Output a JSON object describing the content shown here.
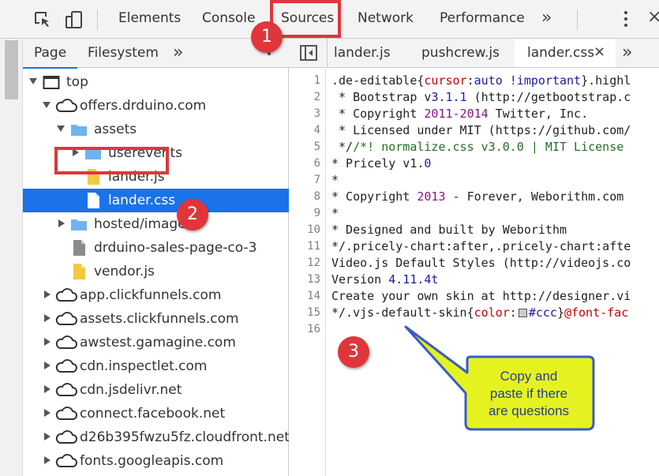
{
  "toolbar": {
    "tabs": [
      "Elements",
      "Console",
      "Sources",
      "Network",
      "Performance"
    ],
    "more": "»",
    "close": "×"
  },
  "navigator": {
    "tabs": [
      "Page",
      "Filesystem"
    ],
    "more": "»",
    "tree": [
      {
        "label": "top",
        "icon": "frame-icon",
        "expanded": true
      },
      {
        "label": "offers.drduino.com",
        "icon": "cloud-icon",
        "expanded": true
      },
      {
        "label": "assets",
        "icon": "folder-icon",
        "expanded": true
      },
      {
        "label": "userevents",
        "icon": "folder-icon",
        "expanded": false
      },
      {
        "label": "lander.js",
        "icon": "js-file-icon"
      },
      {
        "label": "lander.css",
        "icon": "css-file-icon",
        "selected": true
      },
      {
        "label": "hosted/images",
        "icon": "folder-icon",
        "expanded": false
      },
      {
        "label": "drduino-sales-page-co-3",
        "icon": "file-icon"
      },
      {
        "label": "vendor.js",
        "icon": "js-file-icon"
      },
      {
        "label": "app.clickfunnels.com",
        "icon": "cloud-icon",
        "expanded": false
      },
      {
        "label": "assets.clickfunnels.com",
        "icon": "cloud-icon",
        "expanded": false
      },
      {
        "label": "awstest.gamagine.com",
        "icon": "cloud-icon",
        "expanded": false
      },
      {
        "label": "cdn.inspectlet.com",
        "icon": "cloud-icon",
        "expanded": false
      },
      {
        "label": "cdn.jsdelivr.net",
        "icon": "cloud-icon",
        "expanded": false
      },
      {
        "label": "connect.facebook.net",
        "icon": "cloud-icon",
        "expanded": false
      },
      {
        "label": "d26b395fwzu5fz.cloudfront.net",
        "icon": "cloud-icon",
        "expanded": false
      },
      {
        "label": "fonts.googleapis.com",
        "icon": "cloud-icon",
        "expanded": false
      }
    ]
  },
  "editor": {
    "tabs": [
      "lander.js",
      "pushcrew.js",
      "lander.css"
    ],
    "active_tab": "lander.css",
    "close": "×",
    "more": "»",
    "line_numbers": [
      "1",
      "2",
      "3",
      "4",
      "5",
      "6",
      "7",
      "8",
      "9",
      "10",
      "11",
      "12",
      "13",
      "14",
      "15",
      "16"
    ],
    "lines": {
      "l1a": ".de-editable{",
      "l1b": "cursor",
      "l1c": ":",
      "l1d": "auto !important",
      "l1e": "}.highl",
      "l2a": " * Bootstrap v",
      "l2b": "3.1.1",
      "l2c": " (http://getbootstrap.c",
      "l3a": " * Copyright ",
      "l3b": "2011-2014",
      "l3c": " Twitter, Inc.",
      "l4": " * Licensed under MIT (https://github.com/",
      "l5a": " */",
      "l5b": "/*! normalize.css v3.0.0 | MIT License",
      "l6a": "* Pricely v1.",
      "l6b": "0",
      "l7": "*",
      "l8a": "* Copyright ",
      "l8b": "2013",
      "l8c": " - Forever, Weborithm.com",
      "l9": "*",
      "l10": "* Designed and built by Weborithm",
      "l11": "*/.pricely-chart:after,.pricely-chart:afte",
      "l12": "Video.js Default Styles (http://videojs.co",
      "l13a": "Version ",
      "l13b": "4.11.4t",
      "l14": "Create your own skin at http://designer.vi",
      "l15a": "*/.vjs-default-skin{",
      "l15b": "color",
      "l15c": ":",
      "l15d": "#ccc",
      "l15e": "}",
      "l15f": "@font-fac",
      "l16": ""
    }
  },
  "annotations": {
    "badges": [
      "1",
      "2",
      "3"
    ],
    "callout": [
      "Copy and",
      "paste if there",
      "are questions"
    ],
    "badge_color": "#e0363b",
    "callout_fill": "#e6f21f",
    "callout_stroke": "#3a5bc7"
  }
}
